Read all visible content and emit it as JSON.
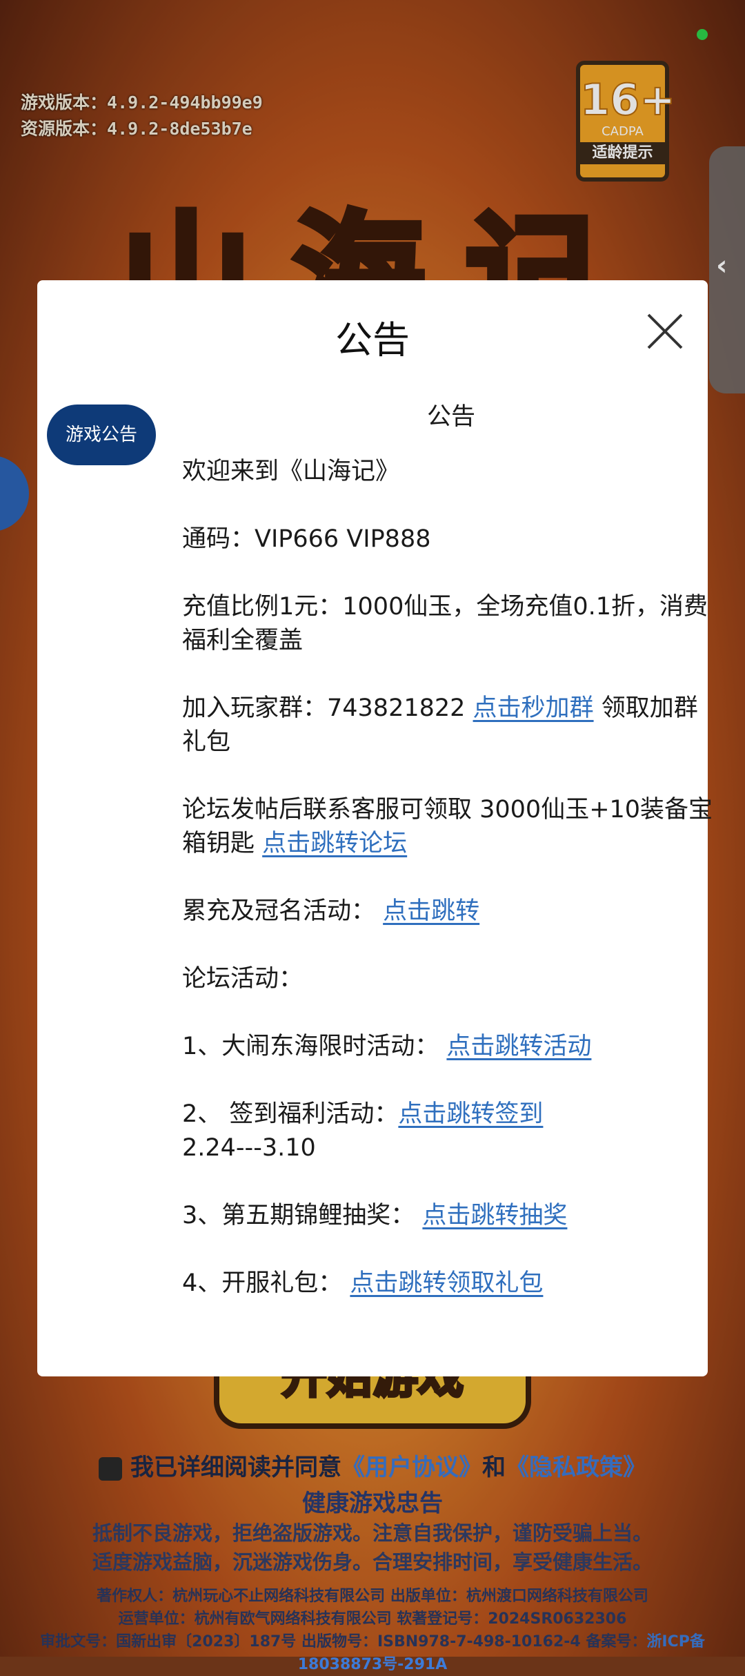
{
  "background": {
    "game_title": "山海记",
    "version": {
      "game_label": "游戏版本：",
      "game_value": "4.9.2-494bb99e9",
      "resource_label": "资源版本：",
      "resource_value": "4.9.2-8de53b7e"
    },
    "age_badge": {
      "age": "16+",
      "org": "CADPA",
      "tip": "适龄提示"
    },
    "start_button": "开始游戏",
    "agreement": {
      "text": "我已详细阅读并同意",
      "user_agreement": "《用户协议》",
      "and": "和",
      "privacy_policy": "《隐私政策》"
    },
    "health_title": "健康游戏忠告",
    "health_line1": "抵制不良游戏，拒绝盗版游戏。注意自我保护，谨防受骗上当。",
    "health_line2": "适度游戏益脑，沉迷游戏伤身。合理安排时间，享受健康生活。",
    "footer_line1": "著作权人：杭州玩心不止网络科技有限公司  出版单位：杭州渡口网络科技有限公司",
    "footer_line2": "运营单位：杭州有欧气网络科技有限公司  软著登记号：2024SR0632306",
    "footer_line3_a": "审批文号：国新出审〔2023〕187号 出版物号：ISBN978-7-498-10162-4 备案号：",
    "footer_line3_link": "浙ICP备18038873号-291A"
  },
  "modal": {
    "title": "公告",
    "tab_label": "游戏公告",
    "content_heading": "公告",
    "welcome": "欢迎来到《山海记》",
    "code": "通码：VIP666 VIP888",
    "recharge": "充值比例1元：1000仙玉，全场充值0.1折，消费福利全覆盖",
    "group_text": "加入玩家群：743821822 ",
    "group_link": "点击秒加群",
    "group_tail": " 领取加群礼包",
    "forum_text": "论坛发帖后联系客服可领取 3000仙玉+10装备宝箱钥匙 ",
    "forum_link": "点击跳转论坛",
    "cumulative_text": "累充及冠名活动：  ",
    "cumulative_link": "点击跳转",
    "forum_activity": "论坛活动：",
    "act1_text": "1、大闹东海限时活动：  ",
    "act1_link": "点击跳转活动",
    "act2_text": "2、 签到福利活动：",
    "act2_link": "点击跳转签到",
    "act2_date": "2.24---3.10",
    "act3_text": "3、第五期锦鲤抽奖：  ",
    "act3_link": "点击跳转抽奖",
    "act4_text": "4、开服礼包：  ",
    "act4_link": "点击跳转领取礼包"
  },
  "colors": {
    "accent_tab": "#0e3a78",
    "link": "#2f6fbe",
    "status_dot": "#2ed24a"
  }
}
